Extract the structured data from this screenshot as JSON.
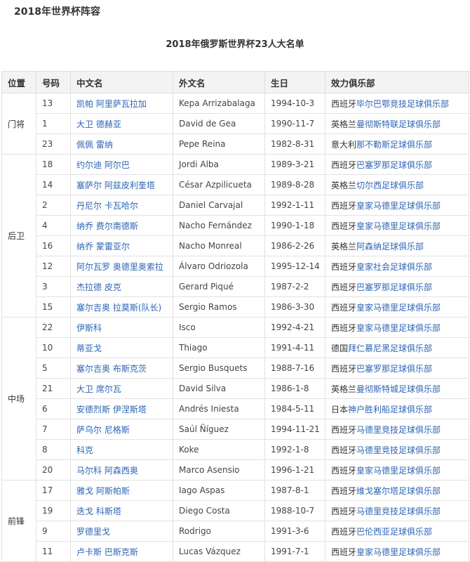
{
  "page_heading": "2018年世界杯阵容",
  "table_title": "2018年俄罗斯世界杯23人大名单",
  "columns": [
    "位置",
    "号码",
    "中文名",
    "外文名",
    "生日",
    "效力俱乐部"
  ],
  "groups": [
    {
      "position": "门将",
      "players": [
        {
          "number": "13",
          "cn_name": "凯帕 阿里萨瓦拉加",
          "foreign_name": "Kepa Arrizabalaga",
          "birth": "1994-10-3",
          "club_country": "西班牙",
          "club": "毕尔巴鄂竞技足球俱乐部"
        },
        {
          "number": "1",
          "cn_name": "大卫 德赫亚",
          "foreign_name": "David de Gea",
          "birth": "1990-11-7",
          "club_country": "英格兰",
          "club": "曼彻斯特联足球俱乐部"
        },
        {
          "number": "23",
          "cn_name": "佩佩 雷纳",
          "foreign_name": "Pepe Reina",
          "birth": "1982-8-31",
          "club_country": "意大利",
          "club": "那不勒斯足球俱乐部"
        }
      ]
    },
    {
      "position": "后卫",
      "players": [
        {
          "number": "18",
          "cn_name": "约尔迪 阿尔巴",
          "foreign_name": "Jordi Alba",
          "birth": "1989-3-21",
          "club_country": "西班牙",
          "club": "巴塞罗那足球俱乐部"
        },
        {
          "number": "14",
          "cn_name": "塞萨尔 阿兹皮利奎塔",
          "foreign_name": "César Azpilicueta",
          "birth": "1989-8-28",
          "club_country": "英格兰",
          "club": "切尔西足球俱乐部"
        },
        {
          "number": "2",
          "cn_name": "丹尼尔 卡瓦哈尔",
          "foreign_name": "Daniel Carvajal",
          "birth": "1992-1-11",
          "club_country": "西班牙",
          "club": "皇家马德里足球俱乐部"
        },
        {
          "number": "4",
          "cn_name": "纳乔 费尔南德斯",
          "foreign_name": "Nacho Fernández",
          "birth": "1990-1-18",
          "club_country": "西班牙",
          "club": "皇家马德里足球俱乐部"
        },
        {
          "number": "16",
          "cn_name": "纳乔 蒙雷亚尔",
          "foreign_name": "Nacho Monreal",
          "birth": "1986-2-26",
          "club_country": "英格兰",
          "club": "阿森纳足球俱乐部"
        },
        {
          "number": "12",
          "cn_name": "阿尔瓦罗 奥德里奥索拉",
          "foreign_name": "Álvaro Odriozola",
          "birth": "1995-12-14",
          "club_country": "西班牙",
          "club": "皇家社会足球俱乐部"
        },
        {
          "number": "3",
          "cn_name": "杰拉德 皮克",
          "foreign_name": "Gerard Piqué",
          "birth": "1987-2-2",
          "club_country": "西班牙",
          "club": "巴塞罗那足球俱乐部"
        },
        {
          "number": "15",
          "cn_name": "塞尔吉奥 拉莫斯(队长)",
          "foreign_name": "Sergio Ramos",
          "birth": "1986-3-30",
          "club_country": "西班牙",
          "club": "皇家马德里足球俱乐部"
        }
      ]
    },
    {
      "position": "中场",
      "players": [
        {
          "number": "22",
          "cn_name": "伊斯科",
          "foreign_name": "Isco",
          "birth": "1992-4-21",
          "club_country": "西班牙",
          "club": "皇家马德里足球俱乐部"
        },
        {
          "number": "10",
          "cn_name": "蒂亚戈",
          "foreign_name": "Thiago",
          "birth": "1991-4-11",
          "club_country": "德国",
          "club": "拜仁慕尼黑足球俱乐部"
        },
        {
          "number": "5",
          "cn_name": "塞尔吉奥 布斯克茨",
          "foreign_name": "Sergio Busquets",
          "birth": "1988-7-16",
          "club_country": "西班牙",
          "club": "巴塞罗那足球俱乐部"
        },
        {
          "number": "21",
          "cn_name": "大卫 席尔瓦",
          "foreign_name": "David Silva",
          "birth": "1986-1-8",
          "club_country": "英格兰",
          "club": "曼彻斯特城足球俱乐部"
        },
        {
          "number": "6",
          "cn_name": "安德烈斯 伊涅斯塔",
          "foreign_name": "Andrés Iniesta",
          "birth": "1984-5-11",
          "club_country": "日本",
          "club": "神户胜利船足球俱乐部"
        },
        {
          "number": "7",
          "cn_name": "萨乌尔 尼格斯",
          "foreign_name": "Saúl Ñíguez",
          "birth": "1994-11-21",
          "club_country": "西班牙",
          "club": "马德里竞技足球俱乐部"
        },
        {
          "number": "8",
          "cn_name": "科克",
          "foreign_name": "Koke",
          "birth": "1992-1-8",
          "club_country": "西班牙",
          "club": "马德里竞技足球俱乐部"
        },
        {
          "number": "20",
          "cn_name": "马尔科 阿森西奥",
          "foreign_name": "Marco Asensio",
          "birth": "1996-1-21",
          "club_country": "西班牙",
          "club": "皇家马德里足球俱乐部"
        }
      ]
    },
    {
      "position": "前锋",
      "players": [
        {
          "number": "17",
          "cn_name": "雅戈 阿斯帕斯",
          "foreign_name": "Iago Aspas",
          "birth": "1987-8-1",
          "club_country": "西班牙",
          "club": "维戈塞尔塔足球俱乐部"
        },
        {
          "number": "19",
          "cn_name": "迭戈 科斯塔",
          "foreign_name": "Diego Costa",
          "birth": "1988-10-7",
          "club_country": "西班牙",
          "club": "马德里竞技足球俱乐部"
        },
        {
          "number": "9",
          "cn_name": "罗德里戈",
          "foreign_name": "Rodrigo",
          "birth": "1991-3-6",
          "club_country": "西班牙",
          "club": "巴伦西亚足球俱乐部"
        },
        {
          "number": "11",
          "cn_name": "卢卡斯 巴斯克斯",
          "foreign_name": "Lucas Vázquez",
          "birth": "1991-7-1",
          "club_country": "西班牙",
          "club": "皇家马德里足球俱乐部"
        }
      ]
    }
  ]
}
